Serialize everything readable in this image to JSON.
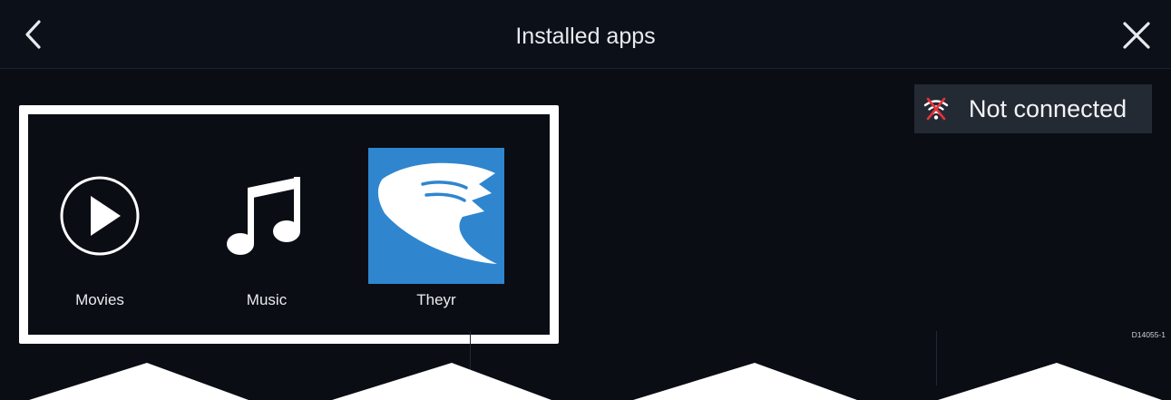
{
  "header": {
    "title": "Installed apps",
    "back_icon": "chevron-left-icon",
    "close_icon": "close-icon"
  },
  "connection": {
    "status_text": "Not connected",
    "icon": "wifi-off-icon",
    "icon_color": "#e8323c"
  },
  "apps": [
    {
      "label": "Movies",
      "icon": "play-circle-icon"
    },
    {
      "label": "Music",
      "icon": "music-note-icon"
    },
    {
      "label": "Theyr",
      "icon": "theyr-logo-icon",
      "tile_color": "#2f86cf"
    }
  ],
  "figure_code": "D14055-1",
  "colors": {
    "background": "#0a0d14",
    "highlight_border": "#ffffff",
    "text": "#e8eaee"
  }
}
